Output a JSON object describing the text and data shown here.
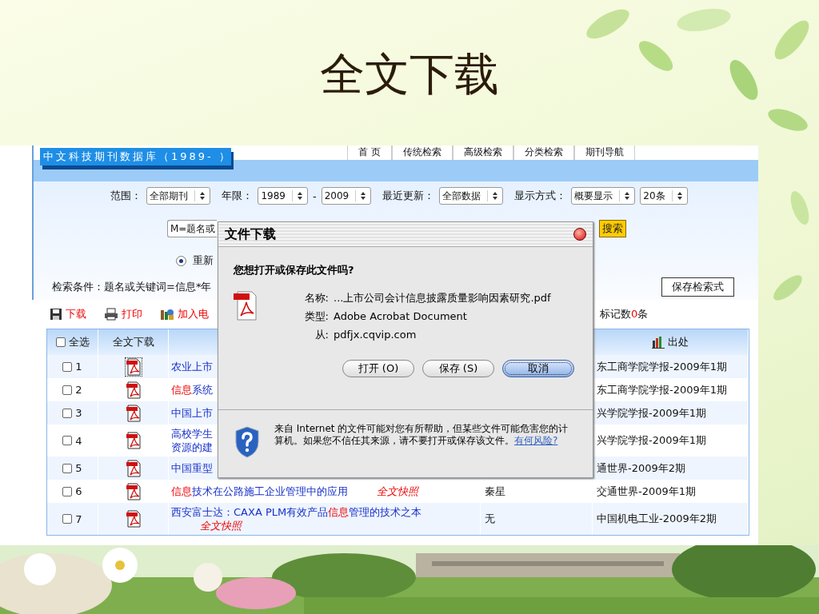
{
  "slide": {
    "title": "全文下载"
  },
  "site": {
    "logo": "中文科技期刊数据库（1989- ）",
    "nav": [
      {
        "label": "首 页"
      },
      {
        "label": "传统检索"
      },
      {
        "label": "高级检索"
      },
      {
        "label": "分类检索"
      },
      {
        "label": "期刊导航"
      }
    ]
  },
  "filters": [
    {
      "label": "范围：",
      "selects": [
        "全部期刊"
      ]
    },
    {
      "label": "年限：",
      "selects": [
        "1989",
        "2009"
      ],
      "separator": "-"
    },
    {
      "label": "最近更新：",
      "selects": [
        "全部数据"
      ]
    },
    {
      "label": "显示方式：",
      "selects": [
        "概要显示",
        "20条"
      ]
    }
  ],
  "search": {
    "field_select": "M=题名或",
    "button": "搜索"
  },
  "mode": {
    "label": "重新",
    "selected": true
  },
  "condition": "检索条件：题名或关键词=信息*年",
  "save_button": "保存检索式",
  "toolbar": {
    "actions": [
      {
        "kind": "save",
        "label": "下载"
      },
      {
        "kind": "print",
        "label": "打印"
      },
      {
        "kind": "add",
        "label": "加入电"
      }
    ],
    "marked": [
      {
        "text": "标记数",
        "highlight": false
      },
      {
        "text": "0",
        "highlight": true
      },
      {
        "text": "条",
        "highlight": false
      }
    ]
  },
  "table": {
    "select_all": {
      "label": "全选",
      "checked": false
    },
    "download_header": "全文下载",
    "source_header": "出处",
    "rows": [
      {
        "number": "1",
        "checked": false,
        "focused": true,
        "title": [
          {
            "text": "农业上市",
            "highlight": false
          }
        ],
        "source": "东工商学院学报-2009年1期"
      },
      {
        "number": "2",
        "checked": false,
        "focused": false,
        "title": [
          {
            "text": "信息",
            "highlight": true
          },
          {
            "text": "系统",
            "highlight": false
          }
        ],
        "source": "东工商学院学报-2009年1期"
      },
      {
        "number": "3",
        "checked": false,
        "focused": false,
        "title": [
          {
            "text": "中国上市",
            "highlight": false
          }
        ],
        "source": "兴学院学报-2009年1期"
      },
      {
        "number": "4",
        "checked": false,
        "focused": false,
        "title": [
          {
            "text": "高校学生",
            "highlight": false
          },
          {
            "text": "资源的建",
            "highlight": false,
            "newline": true
          }
        ],
        "source": "兴学院学报-2009年1期"
      },
      {
        "number": "5",
        "checked": false,
        "focused": false,
        "title": [
          {
            "text": "中国重型",
            "highlight": false
          }
        ],
        "source": "通世界-2009年2期"
      },
      {
        "number": "6",
        "checked": false,
        "focused": false,
        "title": [
          {
            "text": "信息",
            "highlight": true
          },
          {
            "text": "技术在公路施工企业管理中的应用",
            "highlight": false
          }
        ],
        "snapshot": "全文快照",
        "author": "秦星",
        "source": "交通世界-2009年1期"
      },
      {
        "number": "7",
        "checked": false,
        "focused": false,
        "title": [
          {
            "text": "西安富士达：CAXA PLM有效产品",
            "highlight": false
          },
          {
            "text": "信息",
            "highlight": true
          },
          {
            "text": "管理的技术之本",
            "highlight": false
          }
        ],
        "snapshot": "全文快照",
        "author": "无",
        "source": "中国机电工业-2009年2期"
      }
    ]
  },
  "dialog": {
    "title": "文件下载",
    "question": "您想打开或保存此文件吗?",
    "fields": [
      {
        "label": "名称:",
        "value": "...上市公司会计信息披露质量影响因素研究.pdf"
      },
      {
        "label": "类型:",
        "value": "Adobe Acrobat Document"
      },
      {
        "label": "从:",
        "value": "pdfjx.cqvip.com"
      }
    ],
    "buttons": [
      {
        "label": "打开 (O)",
        "selected": false
      },
      {
        "label": "保存 (S)",
        "selected": false
      },
      {
        "label": "取消",
        "selected": true
      }
    ],
    "warning": "来自 Internet 的文件可能对您有所帮助，但某些文件可能危害您的计算机。如果您不信任其来源，请不要打开或保存该文件。",
    "link": "有何风险?"
  }
}
